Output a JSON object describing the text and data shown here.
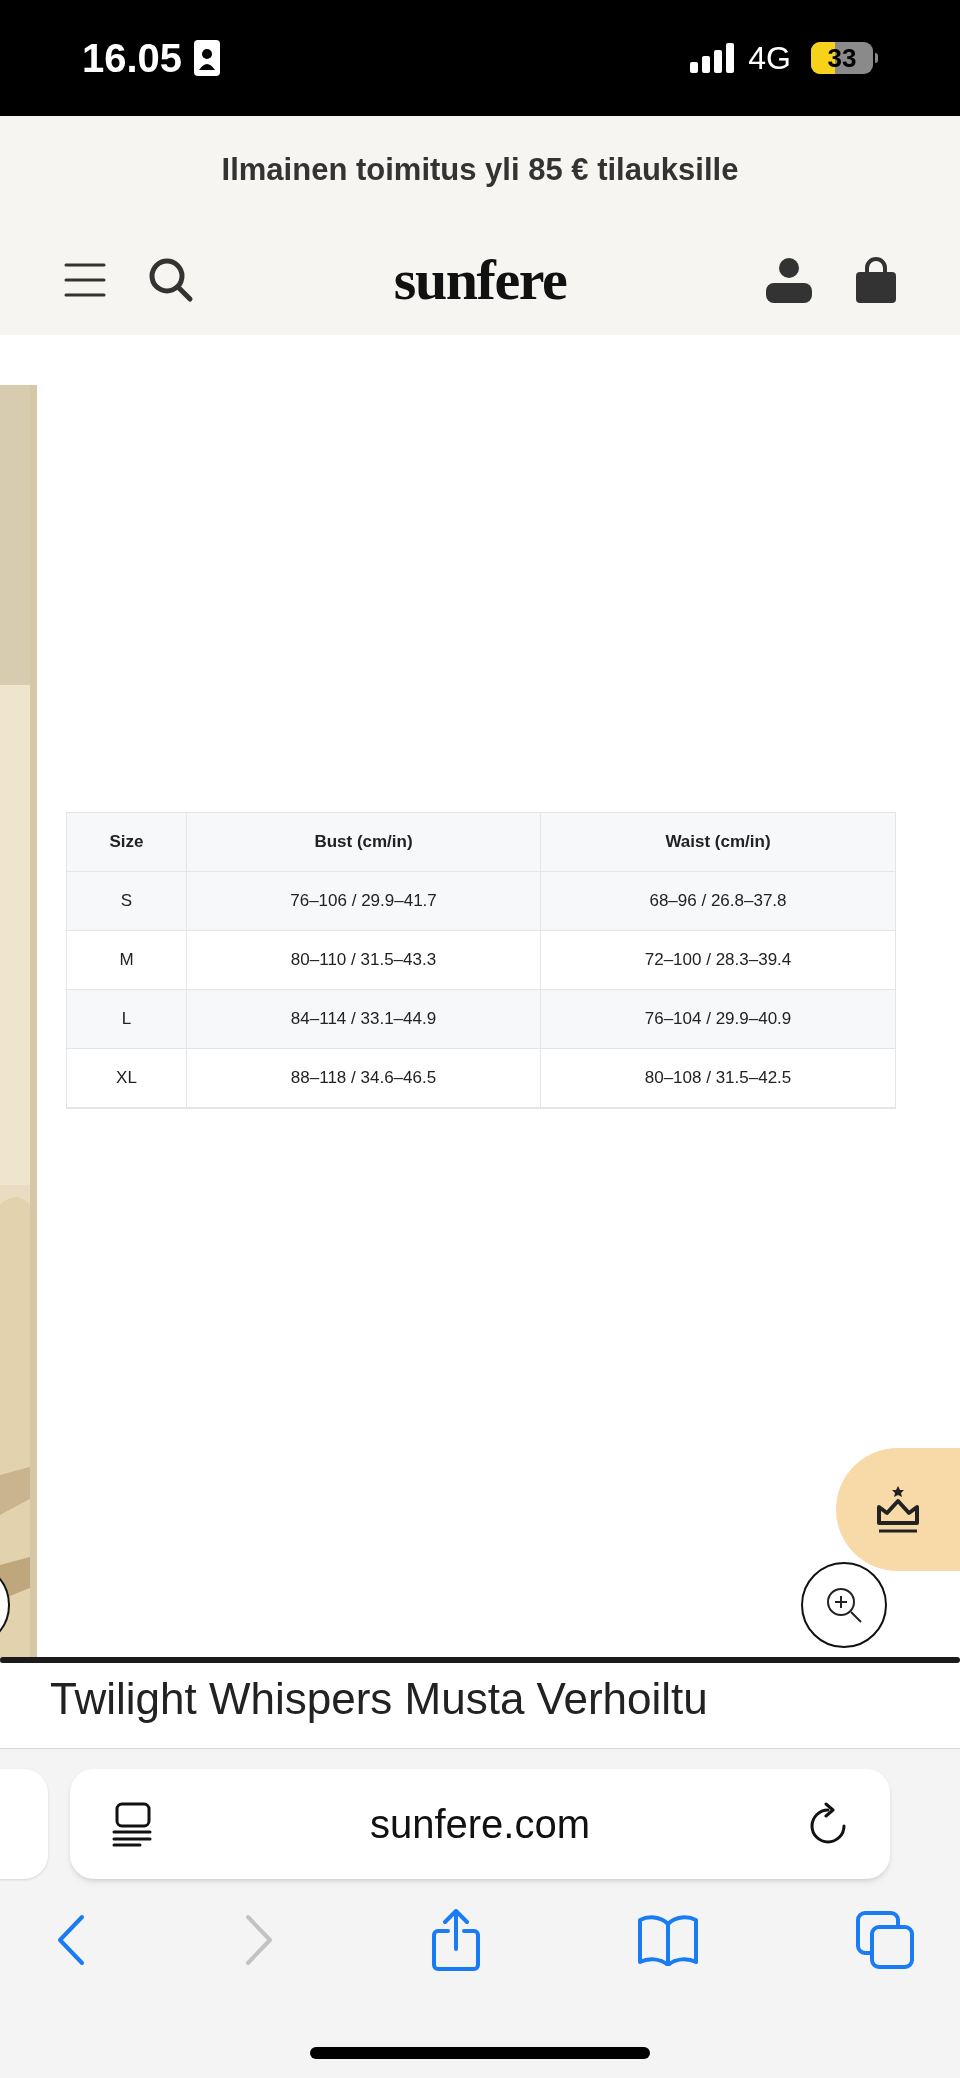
{
  "status_bar": {
    "time": "16.05",
    "network": "4G",
    "battery": "33"
  },
  "promo_banner": {
    "text": "Ilmainen toimitus yli 85 € tilauksille"
  },
  "header": {
    "logo": "sunfere"
  },
  "size_chart": {
    "columns": [
      "Size",
      "Bust (cm/in)",
      "Waist (cm/in)"
    ],
    "rows": [
      [
        "S",
        "76–106 / 29.9–41.7",
        "68–96 / 26.8–37.8"
      ],
      [
        "M",
        "80–110 / 31.5–43.3",
        "72–100 / 28.3–39.4"
      ],
      [
        "L",
        "84–114 / 33.1–44.9",
        "76–104 / 29.9–40.9"
      ],
      [
        "XL",
        "88–118 / 34.6–46.5",
        "80–108 / 31.5–42.5"
      ]
    ]
  },
  "product": {
    "title": "Twilight Whispers Musta Verhoiltu"
  },
  "browser": {
    "url": "sunfere.com",
    "back_enabled": true,
    "forward_enabled": false
  }
}
